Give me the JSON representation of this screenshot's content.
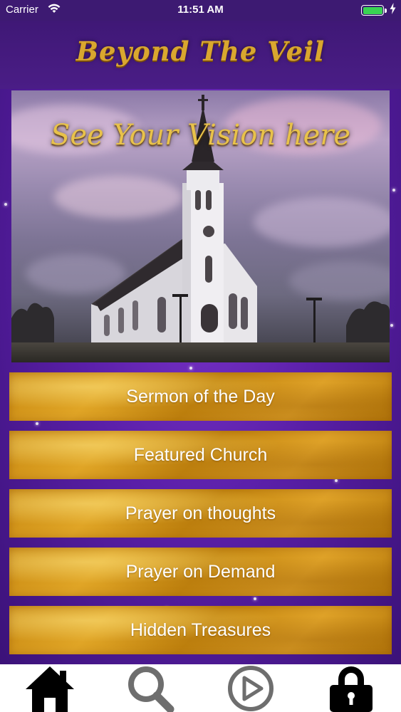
{
  "status_bar": {
    "carrier": "Carrier",
    "time": "11:51 AM",
    "battery_color": "#39d353"
  },
  "header": {
    "title": "Beyond The Veil",
    "title_color": "#d9a72f"
  },
  "hero": {
    "caption": "See Your Vision here",
    "image": "church-photo"
  },
  "menu": {
    "items": [
      {
        "label": "Sermon of the Day"
      },
      {
        "label": "Featured Church"
      },
      {
        "label": "Prayer on thoughts"
      },
      {
        "label": "Prayer on Demand"
      },
      {
        "label": "Hidden Treasures"
      }
    ],
    "button_color": "#d49a1c"
  },
  "tab_bar": {
    "tabs": [
      {
        "icon": "home-icon",
        "color": "#000000"
      },
      {
        "icon": "search-icon",
        "color": "#6e6e6e"
      },
      {
        "icon": "play-icon",
        "color": "#6e6e6e"
      },
      {
        "icon": "lock-icon",
        "color": "#000000"
      }
    ]
  },
  "colors": {
    "background_purple": "#5a1fa8",
    "header_purple": "#3f1876"
  }
}
